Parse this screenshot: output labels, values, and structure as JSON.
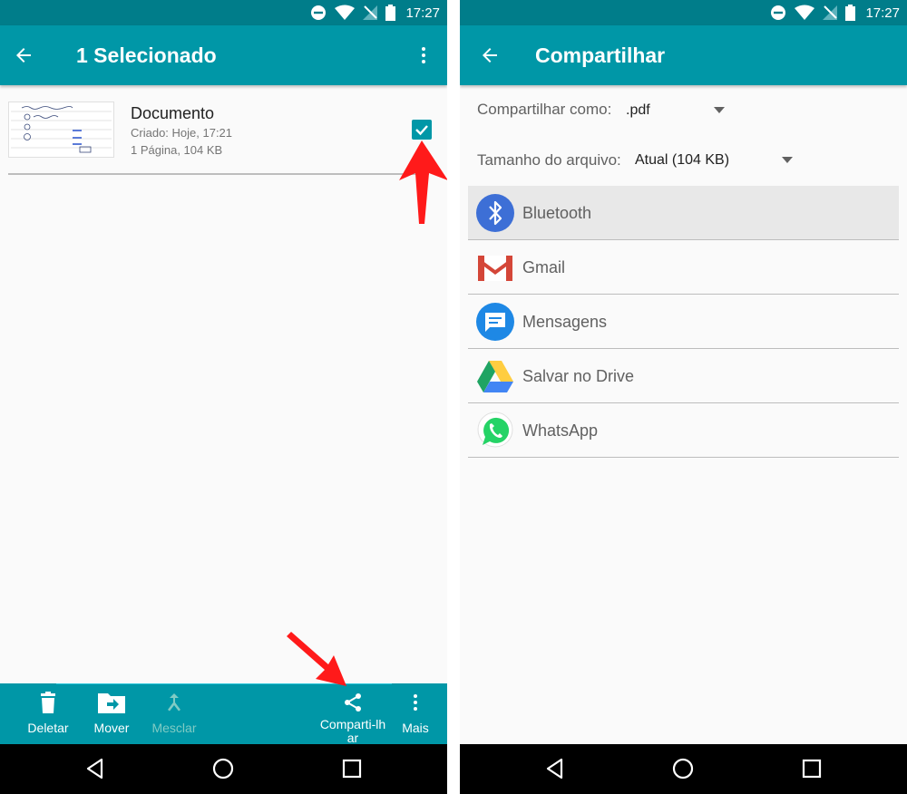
{
  "status": {
    "time": "17:27"
  },
  "selection_screen": {
    "title": "1 Selecionado",
    "document": {
      "name": "Documento",
      "created": "Criado: Hoje, 17:21",
      "info": "1 Página, 104 KB",
      "checked": true
    },
    "actions": [
      {
        "label": "Deletar",
        "icon": "delete-icon",
        "enabled": true
      },
      {
        "label": "Mover",
        "icon": "move-folder-icon",
        "enabled": true
      },
      {
        "label": "Mesclar",
        "icon": "merge-icon",
        "enabled": false
      },
      {
        "label": "Comparti-lhar",
        "icon": "share-icon",
        "enabled": true
      },
      {
        "label": "Mais",
        "icon": "more-vertical-icon",
        "enabled": true
      }
    ]
  },
  "share_screen": {
    "title": "Compartilhar",
    "share_as": {
      "label": "Compartilhar como:",
      "value": ".pdf"
    },
    "file_size": {
      "label": "Tamanho do arquivo:",
      "value": "Atual (104 KB)"
    },
    "targets": [
      {
        "label": "Bluetooth",
        "icon": "bluetooth-icon",
        "color": "#3d6fd6"
      },
      {
        "label": "Gmail",
        "icon": "gmail-icon",
        "color": "#d44638"
      },
      {
        "label": "Mensagens",
        "icon": "messages-icon",
        "color": "#1e88e5"
      },
      {
        "label": "Salvar no Drive",
        "icon": "google-drive-icon",
        "color": "#1fa463"
      },
      {
        "label": "WhatsApp",
        "icon": "whatsapp-icon",
        "color": "#25d366"
      }
    ]
  },
  "colors": {
    "toolbar": "#0097a7",
    "statusbar": "#007d8a",
    "annotation_arrow": "#ff1a1a"
  }
}
